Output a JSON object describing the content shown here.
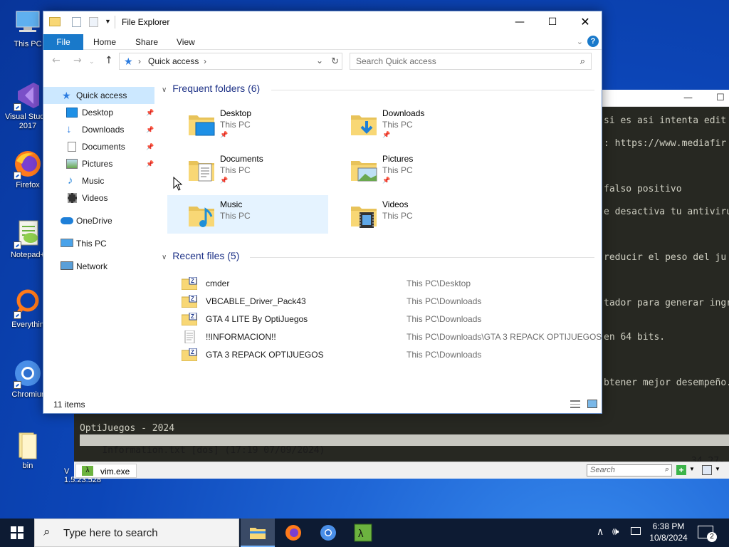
{
  "desktop": {
    "icons": [
      {
        "label": "This PC"
      },
      {
        "label": "Visual Studio 2017"
      },
      {
        "label": "Firefox"
      },
      {
        "label": "Notepad+"
      },
      {
        "label": "Everythin"
      },
      {
        "label": "Chromiur"
      },
      {
        "label": "bin"
      }
    ],
    "partial_label": "V\n1.5.23.528"
  },
  "vim": {
    "lines": [
      "si es asi intenta edit",
      ": https://www.mediafir",
      "falso positivo",
      "e desactiva tu antiviru",
      "reducir el peso del ju",
      "tador para generar ingr",
      "en 64 bits.",
      "btener mejor desempeño.",
      "OptiJuegos - 2024"
    ],
    "status_left": "Information.txt [dos] (17:19 07/09/2024)",
    "status_right": "34,27-",
    "tab_label": "vim.exe",
    "search_placeholder": "Search"
  },
  "explorer": {
    "title": "File Explorer",
    "ribbon_tabs": [
      "File",
      "Home",
      "Share",
      "View"
    ],
    "address": "Quick access",
    "search_placeholder": "Search Quick access",
    "nav": [
      {
        "label": "Quick access",
        "pinned": false
      },
      {
        "label": "Desktop",
        "pinned": true
      },
      {
        "label": "Downloads",
        "pinned": true
      },
      {
        "label": "Documents",
        "pinned": true
      },
      {
        "label": "Pictures",
        "pinned": true
      },
      {
        "label": "Music",
        "pinned": false
      },
      {
        "label": "Videos",
        "pinned": false
      },
      {
        "label": "OneDrive",
        "pinned": false
      },
      {
        "label": "This PC",
        "pinned": false
      },
      {
        "label": "Network",
        "pinned": false
      }
    ],
    "frequent_header": "Frequent folders (6)",
    "frequent": [
      {
        "name": "Desktop",
        "location": "This PC",
        "pinned": true
      },
      {
        "name": "Downloads",
        "location": "This PC",
        "pinned": true
      },
      {
        "name": "Documents",
        "location": "This PC",
        "pinned": true
      },
      {
        "name": "Pictures",
        "location": "This PC",
        "pinned": true
      },
      {
        "name": "Music",
        "location": "This PC",
        "pinned": false
      },
      {
        "name": "Videos",
        "location": "This PC",
        "pinned": false
      }
    ],
    "recent_header": "Recent files (5)",
    "recent": [
      {
        "name": "cmder",
        "path": "This PC\\Desktop"
      },
      {
        "name": "VBCABLE_Driver_Pack43",
        "path": "This PC\\Downloads"
      },
      {
        "name": "GTA 4 LITE By OptiJuegos",
        "path": "This PC\\Downloads"
      },
      {
        "name": "!!INFORMACION!!",
        "path": "This PC\\Downloads\\GTA 3 REPACK OPTIJUEGOS"
      },
      {
        "name": "GTA 3 REPACK OPTIJUEGOS",
        "path": "This PC\\Downloads"
      }
    ],
    "item_count": "11 items"
  },
  "taskbar": {
    "search_placeholder": "Type here to search",
    "time": "6:38 PM",
    "date": "10/8/2024",
    "notification_count": "2"
  },
  "colors": {
    "accent": "#1979ca",
    "group_header": "#1e3287",
    "selection": "#cce8ff",
    "folder": "#f8d775"
  }
}
